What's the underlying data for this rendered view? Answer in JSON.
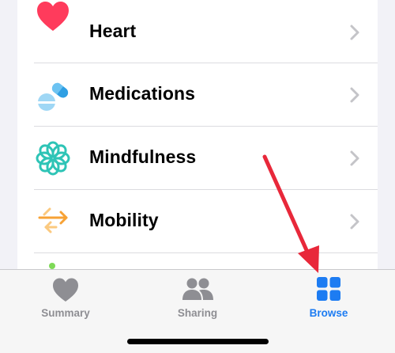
{
  "categories": [
    {
      "label": "Heart",
      "icon": "heart-icon",
      "color": "#ff3b5c"
    },
    {
      "label": "Medications",
      "icon": "pills-icon",
      "color": "#3aaee8"
    },
    {
      "label": "Mindfulness",
      "icon": "mindfulness-flower-icon",
      "color": "#2ec4b6"
    },
    {
      "label": "Mobility",
      "icon": "mobility-arrows-icon",
      "color": "#f7a235"
    }
  ],
  "tabbar": {
    "tabs": [
      {
        "label": "Summary",
        "icon": "heart-icon",
        "active": false
      },
      {
        "label": "Sharing",
        "icon": "people-icon",
        "active": false
      },
      {
        "label": "Browse",
        "icon": "grid-icon",
        "active": true
      }
    ],
    "active_color": "#1d7cf2",
    "inactive_color": "#8e8e93"
  },
  "annotation": {
    "icon": "red-arrow-icon",
    "color": "#e8283a"
  }
}
